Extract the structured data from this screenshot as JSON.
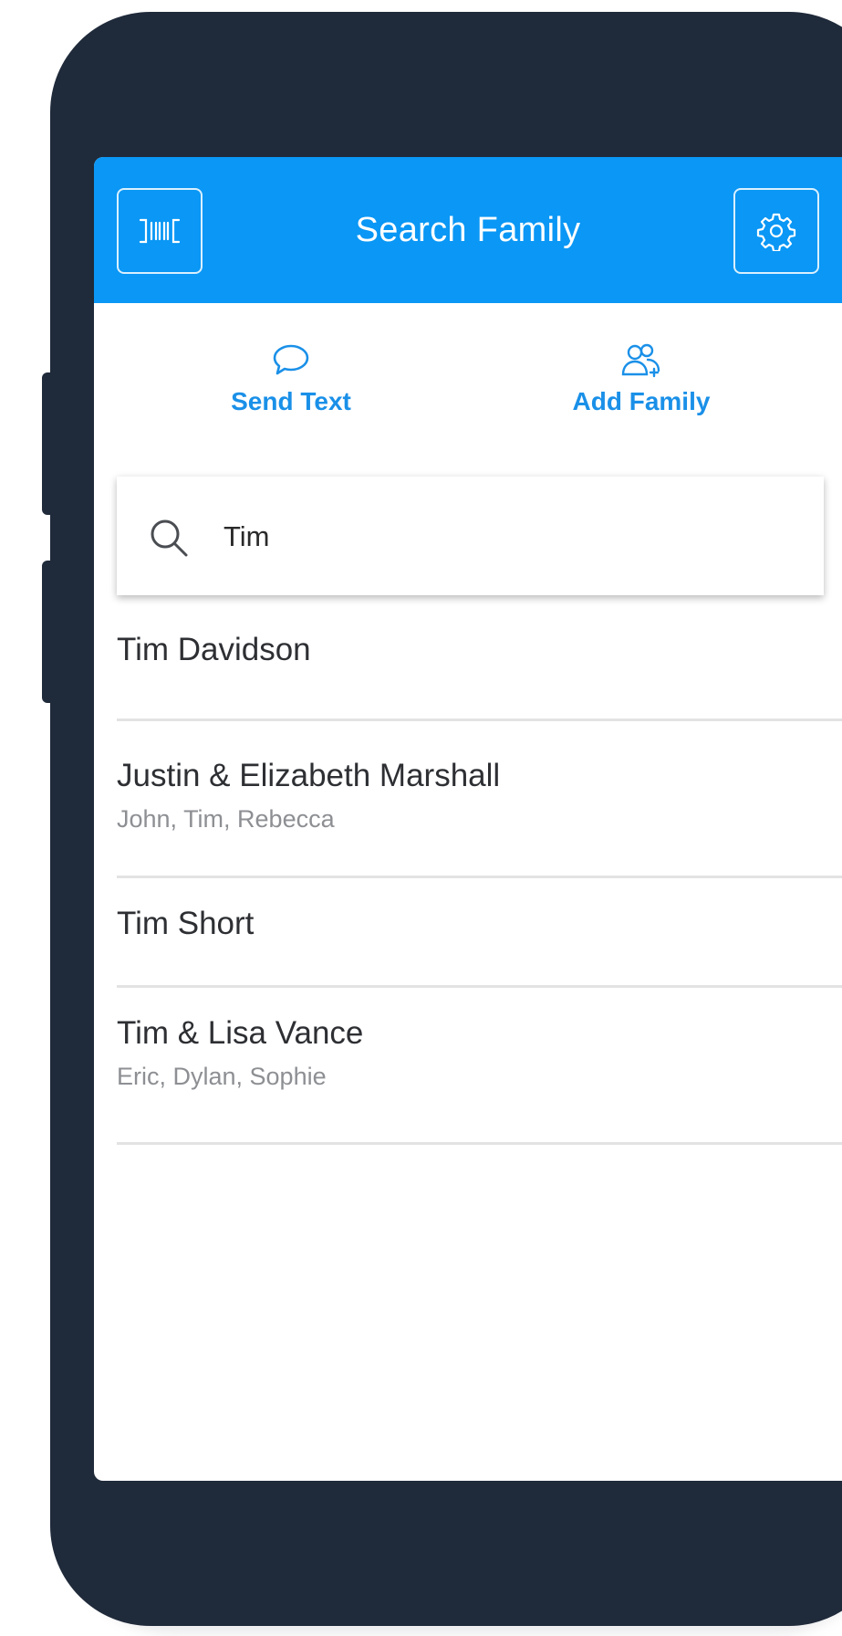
{
  "header": {
    "title": "Search Family",
    "left_icon": "barcode-scan-icon",
    "right_icon": "gear-icon"
  },
  "actions": {
    "send_text": {
      "label": "Send Text",
      "icon": "chat-bubble-icon"
    },
    "add_family": {
      "label": "Add Family",
      "icon": "add-people-icon"
    }
  },
  "search": {
    "value": "Tim",
    "icon": "search-icon"
  },
  "results": [
    {
      "name": "Tim Davidson",
      "members": ""
    },
    {
      "name": "Justin & Elizabeth Marshall",
      "members": "John, Tim, Rebecca"
    },
    {
      "name": "Tim Short",
      "members": ""
    },
    {
      "name": "Tim & Lisa Vance",
      "members": "Eric, Dylan, Sophie"
    }
  ],
  "colors": {
    "accent": "#0a97f5",
    "action_text": "#1a90e8",
    "phone_frame": "#1f2a3a"
  }
}
